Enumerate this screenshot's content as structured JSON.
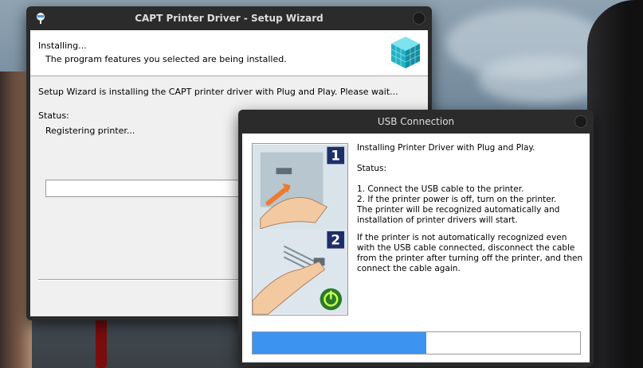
{
  "wizard": {
    "title": "CAPT Printer Driver - Setup Wizard",
    "heading": "Installing...",
    "subheading": "The program features you selected are being installed.",
    "message": "Setup Wizard is installing the CAPT printer driver with Plug and Play. Please wait...",
    "status_label": "Status:",
    "status_value": "Registering printer..."
  },
  "usb_dialog": {
    "title": "USB Connection",
    "intro": "Installing Printer Driver with Plug and Play.",
    "status_label": "Status:",
    "step1": "1. Connect the USB cable to the printer.",
    "step2": "2. If the printer power is off, turn on the printer.",
    "step2b": "The printer will be recognized automatically and",
    "step2c": "installation of printer drivers will start.",
    "note1": "If the printer is not automatically recognized even",
    "note2": "with the USB cable connected, disconnect the cable",
    "note3": "from the printer after turning off the printer, and then",
    "note4": "connect the cable again.",
    "illustration_step1": "1",
    "illustration_step2": "2",
    "progress_fraction": 0.53,
    "progress_color": "#3d93f0"
  }
}
